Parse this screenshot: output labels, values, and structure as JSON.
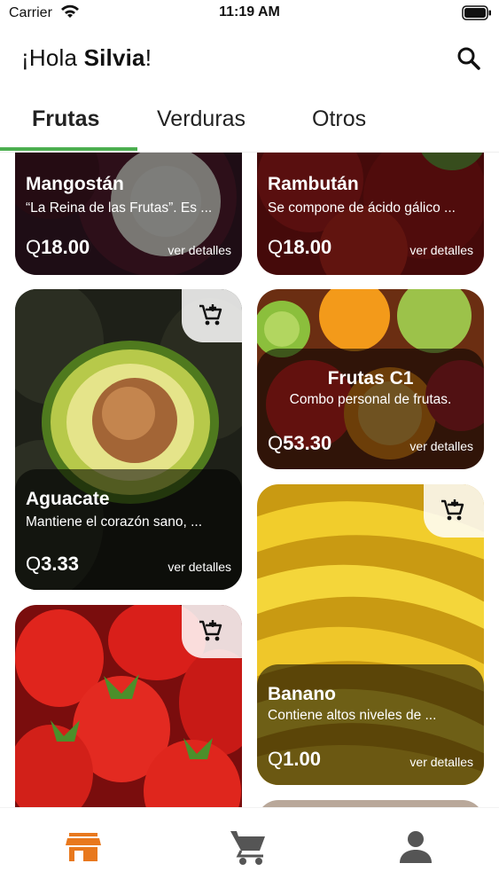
{
  "status_bar": {
    "carrier": "Carrier",
    "time": "11:19 AM"
  },
  "header": {
    "greeting_prefix": "¡Hola ",
    "user_name": "Silvia",
    "greeting_suffix": "!"
  },
  "tabs": [
    {
      "label": "Frutas",
      "active": true
    },
    {
      "label": "Verduras",
      "active": false
    },
    {
      "label": "Otros",
      "active": false
    }
  ],
  "accent_color": "#4caf50",
  "nav_active_color": "#e8781d",
  "products": [
    {
      "id": "mangostan",
      "name": "Mangostán",
      "description": "“La Reina de las Frutas”. Es ...",
      "currency": "Q",
      "price": "18.00",
      "details_label": "ver detalles"
    },
    {
      "id": "rambutan",
      "name": "Rambután",
      "description": "Se compone de ácido gálico ...",
      "currency": "Q",
      "price": "18.00",
      "details_label": "ver detalles"
    },
    {
      "id": "aguacate",
      "name": "Aguacate",
      "description": "Mantiene el corazón sano, ...",
      "currency": "Q",
      "price": "3.33",
      "details_label": "ver detalles"
    },
    {
      "id": "frutas-c1",
      "name": "Frutas C1",
      "description": "Combo personal de frutas.",
      "currency": "Q",
      "price": "53.30",
      "details_label": "ver detalles"
    },
    {
      "id": "banano",
      "name": "Banano",
      "description": "Contiene altos niveles de ...",
      "currency": "Q",
      "price": "1.00",
      "details_label": "ver detalles"
    },
    {
      "id": "fresa",
      "name": "",
      "description": "",
      "currency": "",
      "price": "",
      "details_label": ""
    }
  ],
  "bottom_nav": [
    {
      "icon": "store-icon",
      "active": true
    },
    {
      "icon": "cart-icon",
      "active": false
    },
    {
      "icon": "profile-icon",
      "active": false
    }
  ]
}
